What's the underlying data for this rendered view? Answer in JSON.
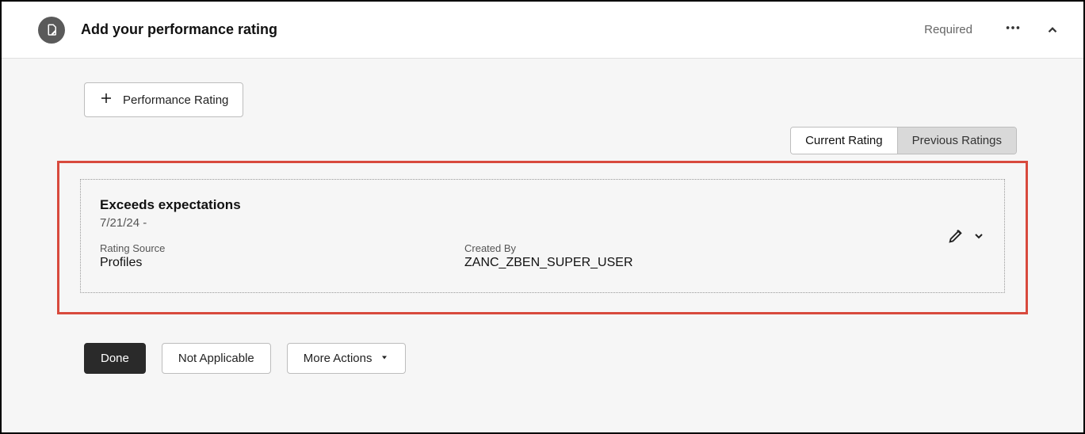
{
  "header": {
    "title": "Add your performance rating",
    "required_label": "Required"
  },
  "add_button_label": "Performance Rating",
  "tabs": {
    "current": "Current Rating",
    "previous": "Previous Ratings"
  },
  "rating_card": {
    "title": "Exceeds expectations",
    "date_range": "7/21/24 -",
    "source_label": "Rating Source",
    "source_value": "Profiles",
    "created_by_label": "Created By",
    "created_by_value": "ZANC_ZBEN_SUPER_USER"
  },
  "footer": {
    "done": "Done",
    "not_applicable": "Not Applicable",
    "more_actions": "More Actions"
  }
}
